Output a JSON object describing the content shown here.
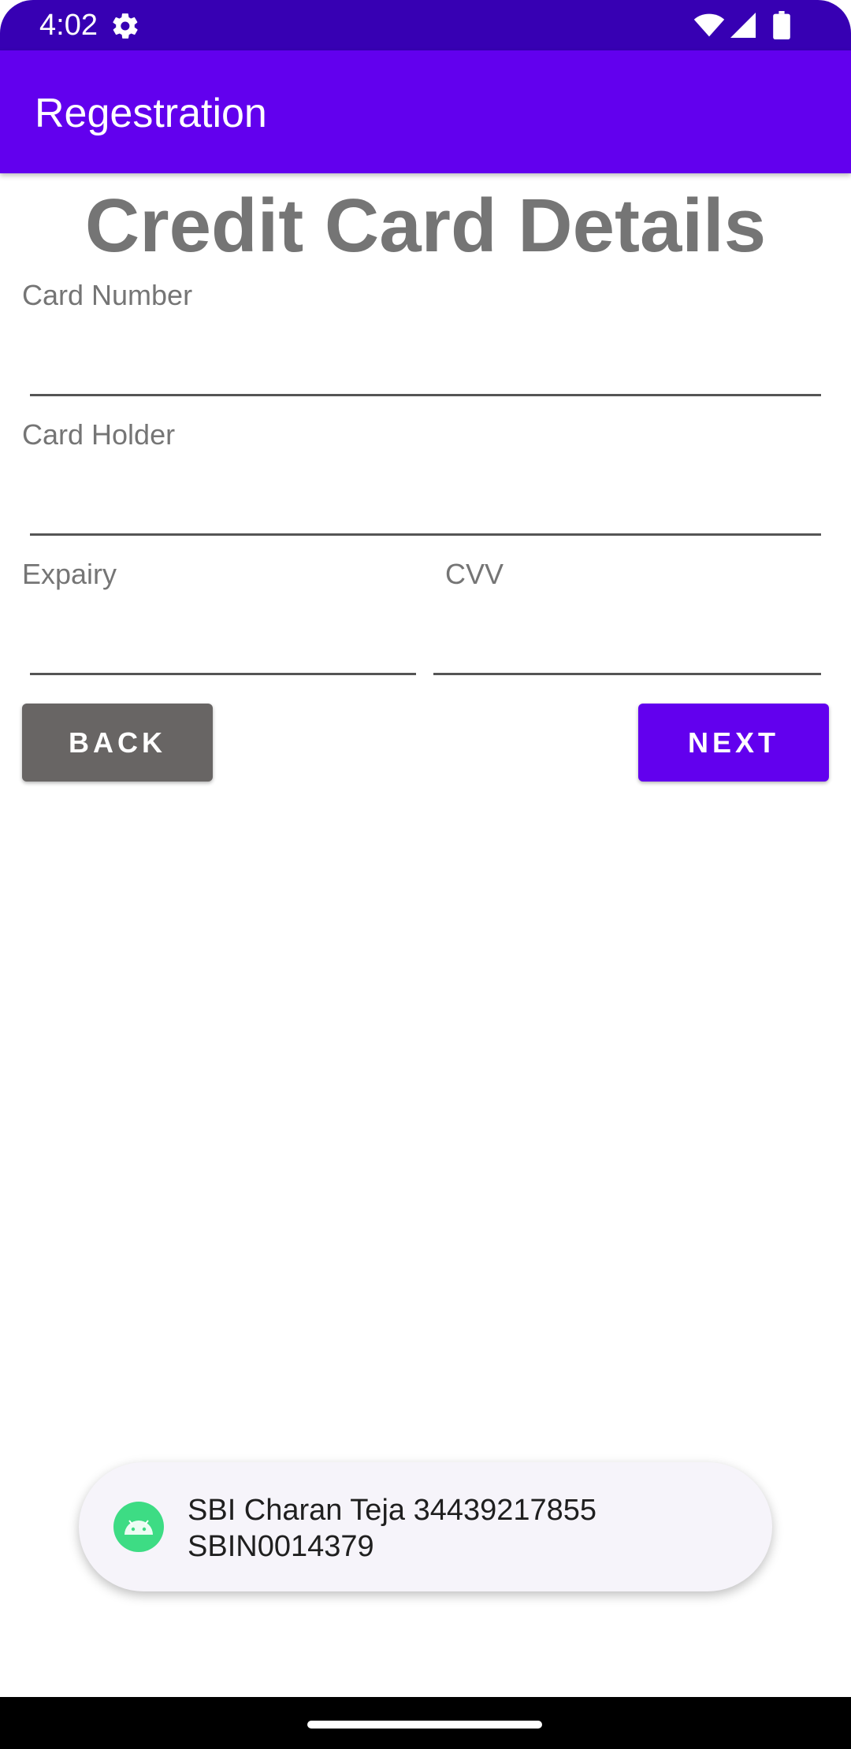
{
  "status_bar": {
    "time": "4:02",
    "icons": [
      "settings-gear-icon",
      "wifi-icon",
      "cellular-signal-icon",
      "battery-icon"
    ]
  },
  "app_bar": {
    "title": "Regestration",
    "color": "#6200ee"
  },
  "page": {
    "title": "Credit Card Details"
  },
  "form": {
    "card_number_label": "Card Number",
    "card_number_value": "",
    "card_holder_label": "Card Holder",
    "card_holder_value": "",
    "expiry_label": "Expairy",
    "expiry_value": "",
    "cvv_label": "CVV",
    "cvv_value": ""
  },
  "buttons": {
    "back_label": "BACK",
    "next_label": "NEXT",
    "back_color": "#686564",
    "next_color": "#6200ee"
  },
  "toast": {
    "line1": "SBI  Charan Teja 34439217855",
    "line2": "SBIN0014379",
    "icon": "android-app-icon"
  },
  "colors": {
    "status_bar": "#3700b3",
    "accent": "#6200ee",
    "label_gray": "#757575"
  }
}
